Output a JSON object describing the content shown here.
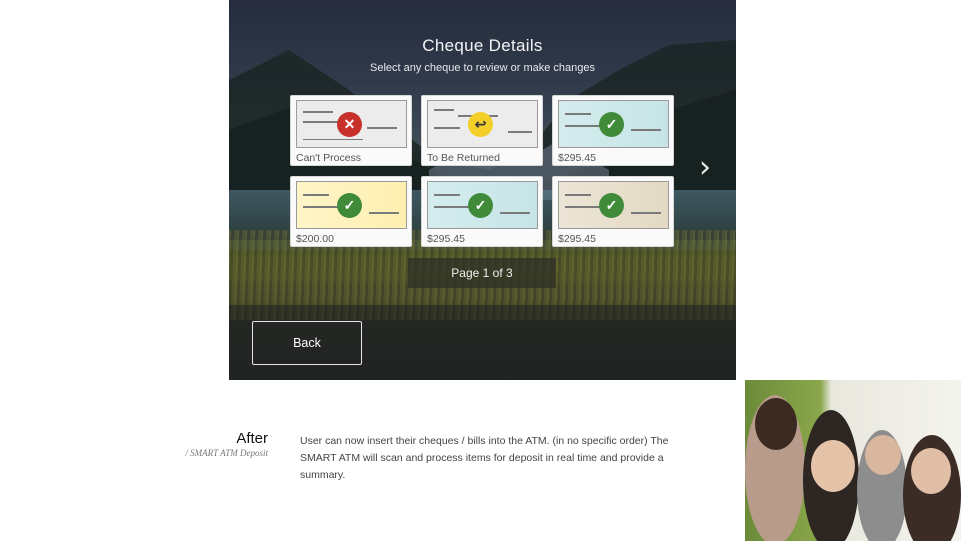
{
  "atm": {
    "title": "Cheque Details",
    "subtitle": "Select any cheque to review or make changes",
    "cheques": [
      {
        "label": "Can't Process",
        "status": "cannot-process",
        "icon": "x-icon",
        "color": "#c8302c"
      },
      {
        "label": "To Be Returned",
        "status": "to-be-returned",
        "icon": "return-arrow-icon",
        "color": "#f4cf2a"
      },
      {
        "label": "$295.45",
        "status": "accepted",
        "icon": "checkmark-icon",
        "color": "#3f8b3a"
      },
      {
        "label": "$200.00",
        "status": "accepted",
        "icon": "checkmark-icon",
        "color": "#3f8b3a"
      },
      {
        "label": "$295.45",
        "status": "accepted",
        "icon": "checkmark-icon",
        "color": "#3f8b3a"
      },
      {
        "label": "$295.45",
        "status": "accepted",
        "icon": "checkmark-icon",
        "color": "#3f8b3a"
      }
    ],
    "pager": "Page 1 of 3",
    "back_label": "Back",
    "next_icon": "chevron-right-icon"
  },
  "caption": {
    "title": "After",
    "subtitle": "/ SMART ATM Deposit",
    "body": "User can now insert their cheques / bills into the ATM. (in no specific order) The SMART ATM will scan and process items for deposit in real time and provide a summary."
  }
}
